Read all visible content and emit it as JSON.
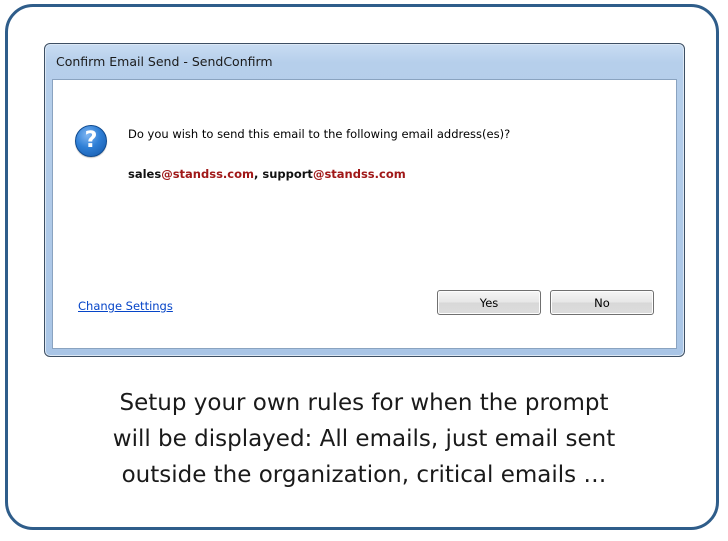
{
  "window": {
    "title": "Confirm Email Send - SendConfirm"
  },
  "dialog": {
    "icon": "question-icon",
    "icon_glyph": "?",
    "question": "Do you wish to send this email to the following email address(es)?",
    "recipients": [
      {
        "user": "sales",
        "domain": "@standss.com",
        "separator": ", "
      },
      {
        "user": "support",
        "domain": "@standss.com",
        "separator": ""
      }
    ],
    "change_settings_label": "Change Settings",
    "yes_label": "Yes",
    "no_label": "No"
  },
  "caption": {
    "lines": [
      "Setup your own rules for when the prompt",
      "will be displayed: All emails, just email sent",
      "outside the organization, critical emails …"
    ]
  },
  "colors": {
    "frame_border": "#2f5d8a",
    "link": "#0645c8",
    "domain_highlight": "#a01818",
    "icon_blue": "#2f7fd6"
  }
}
